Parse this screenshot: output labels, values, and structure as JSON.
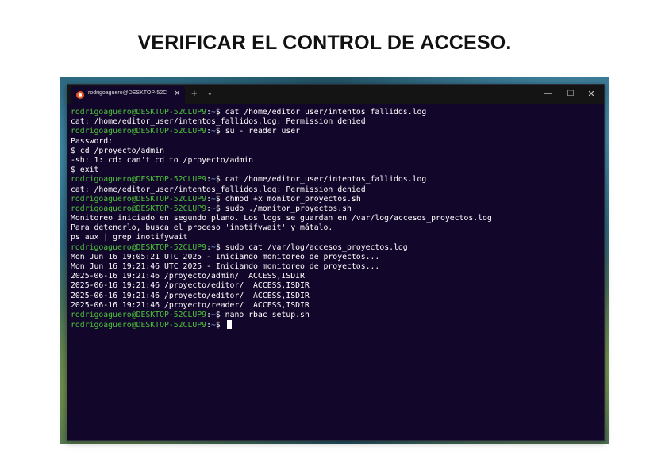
{
  "page": {
    "title": "VERIFICAR EL CONTROL DE ACCESO."
  },
  "terminal": {
    "tab_label": "rodrigoaguero@DESKTOP-52C",
    "tab_close": "✕",
    "new_tab": "+",
    "dropdown": "⌄",
    "window_controls": {
      "minimize": "—",
      "maximize": "☐",
      "close": "✕"
    },
    "prompt_user": "rodrigoaguero@DESKTOP-52CLUP9",
    "prompt_sep": ":",
    "prompt_path": "~",
    "prompt_symbol": "$ ",
    "lines": [
      {
        "type": "prompt",
        "text": "cat /home/editor_user/intentos_fallidos.log"
      },
      {
        "type": "output",
        "text": "cat: /home/editor_user/intentos_fallidos.log: Permission denied"
      },
      {
        "type": "prompt",
        "text": "su - reader_user"
      },
      {
        "type": "output",
        "text": "Password:"
      },
      {
        "type": "output",
        "text": "$ cd /proyecto/admin"
      },
      {
        "type": "output",
        "text": "-sh: 1: cd: can't cd to /proyecto/admin"
      },
      {
        "type": "output",
        "text": "$ exit"
      },
      {
        "type": "prompt",
        "text": "cat /home/editor_user/intentos_fallidos.log"
      },
      {
        "type": "output",
        "text": "cat: /home/editor_user/intentos_fallidos.log: Permission denied"
      },
      {
        "type": "prompt",
        "text": "chmod +x monitor_proyectos.sh"
      },
      {
        "type": "prompt",
        "text": "sudo ./monitor_proyectos.sh"
      },
      {
        "type": "output",
        "text": "Monitoreo iniciado en segundo plano. Los logs se guardan en /var/log/accesos_proyectos.log"
      },
      {
        "type": "output",
        "text": "Para detenerlo, busca el proceso 'inotifywait' y mátalo."
      },
      {
        "type": "output",
        "text": "ps aux | grep inotifywait"
      },
      {
        "type": "prompt",
        "text": "sudo cat /var/log/accesos_proyectos.log"
      },
      {
        "type": "output",
        "text": "Mon Jun 16 19:05:21 UTC 2025 - Iniciando monitoreo de proyectos..."
      },
      {
        "type": "output",
        "text": "Mon Jun 16 19:21:46 UTC 2025 - Iniciando monitoreo de proyectos..."
      },
      {
        "type": "output",
        "text": "2025-06-16 19:21:46 /proyecto/admin/  ACCESS,ISDIR"
      },
      {
        "type": "output",
        "text": "2025-06-16 19:21:46 /proyecto/editor/  ACCESS,ISDIR"
      },
      {
        "type": "output",
        "text": "2025-06-16 19:21:46 /proyecto/editor/  ACCESS,ISDIR"
      },
      {
        "type": "output",
        "text": "2025-06-16 19:21:46 /proyecto/reader/  ACCESS,ISDIR"
      },
      {
        "type": "prompt",
        "text": "nano rbac_setup.sh"
      },
      {
        "type": "prompt_cursor",
        "text": ""
      }
    ]
  },
  "colors": {
    "terminal_bg": "#12062a",
    "prompt_user": "#4ec23c",
    "prompt_path": "#6fa8e8",
    "text": "#ffffff"
  }
}
